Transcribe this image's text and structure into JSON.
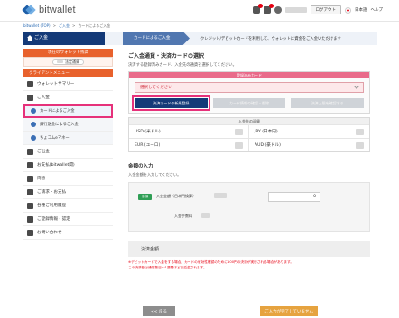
{
  "header": {
    "logo_text": "bitwallet",
    "logout_label": "ログアウト",
    "language": "日本語",
    "help": "ヘルプ"
  },
  "breadcrumb": {
    "items": [
      "bitwallet (TOP)",
      "ご入金",
      "カードによるご入金"
    ],
    "separator": ">"
  },
  "stepbar": {
    "step1": "ご入金",
    "step2": "カードによるご入金",
    "note": "クレジット/デビットカードを利用して、ウォレットに資金をご入金いただけます"
  },
  "sidebar": {
    "wallet_title": "現在のウォレット残高",
    "wallet_pill": "法定通貨",
    "menu_title": "クライアントメニュー",
    "items": [
      {
        "label": "ウォレットサマリー",
        "icon": "wallet-icon",
        "sub": false,
        "active": false
      },
      {
        "label": "ご入金",
        "icon": "deposit-icon",
        "sub": false,
        "active": false
      },
      {
        "label": "カードによるご入金",
        "icon": "card-icon",
        "sub": true,
        "active": true
      },
      {
        "label": "銀行送金によるご入金",
        "icon": "bank-icon",
        "sub": true,
        "active": false
      },
      {
        "label": "ちょコムeマネー",
        "icon": "emoney-icon",
        "sub": true,
        "active": false
      },
      {
        "label": "ご出金",
        "icon": "withdraw-icon",
        "sub": false,
        "active": false
      },
      {
        "label": "お支払(bitwallet間)",
        "icon": "transfer-icon",
        "sub": false,
        "active": false
      },
      {
        "label": "両替",
        "icon": "exchange-icon",
        "sub": false,
        "active": false
      },
      {
        "label": "ご請求・お支払",
        "icon": "invoice-icon",
        "sub": false,
        "active": false
      },
      {
        "label": "各種ご利用履歴",
        "icon": "history-icon",
        "sub": false,
        "active": false
      },
      {
        "label": "ご登録情報・認定",
        "icon": "settings-icon",
        "sub": false,
        "active": false
      },
      {
        "label": "お問い合わせ",
        "icon": "info-icon",
        "sub": false,
        "active": false
      }
    ]
  },
  "main": {
    "section1_title": "ご入金通貨・決済カードの選択",
    "section1_sub": "決済する登録済みカード、入金先の通貨を選択してください。",
    "card_box_title": "登録済みカード",
    "select_placeholder": "選択してください",
    "btn_new_card": "決済カードの新規登録",
    "btn_card_edit": "カード情報の確認・削除",
    "btn_card_limit": "決済上限を確認する",
    "balance_title": "入金先の通貨",
    "balances": [
      {
        "currency": "USD (米ドル)"
      },
      {
        "currency": "JPY (日本円)"
      },
      {
        "currency": "EUR (ユーロ)"
      },
      {
        "currency": "AUD (豪ドル)"
      }
    ],
    "section2_title": "金額の入力",
    "section2_sub": "入金金額を入力してください。",
    "required_badge": "必須",
    "amount_label": "入金金額（日本円換算）",
    "amount_value": "0",
    "fee_label": "入金手数料",
    "total_title": "決済金額",
    "notice": "※デビットカードで入金をする場合、カードの有効性確認のために100円の決済が実行される場合があります。\nこの決済額は通常数日〜1週間ほどで返金されます。",
    "back_label": "<< 戻る",
    "next_label": "ご入力が完了していません"
  },
  "colors": {
    "navy": "#143a78",
    "orange": "#e8612c",
    "pink_highlight": "#e6317a",
    "gold": "#e6a33f"
  }
}
